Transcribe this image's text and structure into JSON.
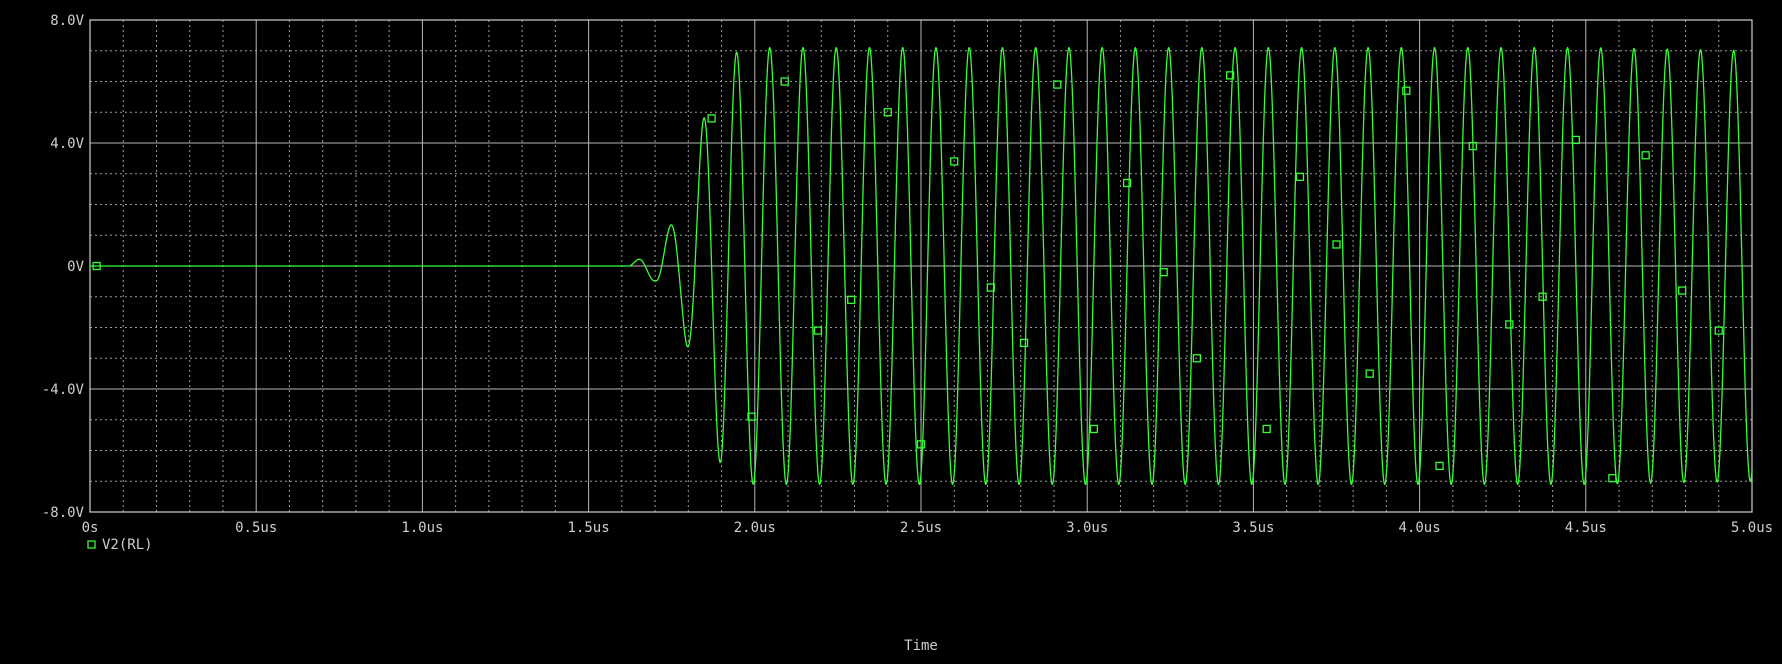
{
  "chart_data": {
    "type": "line",
    "title": "",
    "xlabel": "Time",
    "ylabel": "",
    "xlim": [
      0,
      5.0
    ],
    "ylim": [
      -8.0,
      8.0
    ],
    "x_unit": "us",
    "y_unit": "V",
    "grid": true,
    "legend_placement": "bottom-left",
    "x_ticks": [
      0,
      0.5,
      1.0,
      1.5,
      2.0,
      2.5,
      3.0,
      3.5,
      4.0,
      4.5,
      5.0
    ],
    "x_tick_labels": [
      "0s",
      "0.5us",
      "1.0us",
      "1.5us",
      "2.0us",
      "2.5us",
      "3.0us",
      "3.5us",
      "4.0us",
      "4.5us",
      "5.0us"
    ],
    "y_ticks": [
      8.0,
      4.0,
      0,
      -4.0,
      -8.0
    ],
    "y_tick_labels": [
      "8.0V",
      "4.0V",
      "0V",
      "-4.0V",
      "-8.0V"
    ],
    "series": [
      {
        "name": "V2(RL)",
        "color": "#33ff33",
        "marker": "square",
        "x": [
          0.0,
          1.62,
          1.66,
          1.7,
          1.74,
          1.78,
          1.82,
          1.86,
          1.9,
          1.95,
          2.0,
          2.05,
          2.1,
          2.2,
          2.3,
          2.4,
          2.5,
          3.0,
          3.5,
          4.0,
          4.5,
          5.0
        ],
        "envelope_amplitude": [
          0.0,
          0.0,
          0.3,
          0.5,
          1.2,
          2.0,
          3.5,
          5.5,
          6.5,
          7.0,
          7.1,
          7.1,
          7.1,
          7.1,
          7.1,
          7.1,
          7.1,
          7.1,
          7.1,
          7.1,
          7.1,
          7.0
        ],
        "frequency_mhz": 10.0,
        "marker_points": [
          [
            0.02,
            0.0
          ],
          [
            1.87,
            4.8
          ],
          [
            1.99,
            -4.9
          ],
          [
            2.09,
            6.0
          ],
          [
            2.19,
            -2.1
          ],
          [
            2.29,
            -1.1
          ],
          [
            2.4,
            5.0
          ],
          [
            2.5,
            -5.8
          ],
          [
            2.6,
            3.4
          ],
          [
            2.71,
            -0.7
          ],
          [
            2.81,
            -2.5
          ],
          [
            2.91,
            5.9
          ],
          [
            3.02,
            -5.3
          ],
          [
            3.12,
            2.7
          ],
          [
            3.23,
            -0.2
          ],
          [
            3.33,
            -3.0
          ],
          [
            3.43,
            6.2
          ],
          [
            3.54,
            -5.3
          ],
          [
            3.64,
            2.9
          ],
          [
            3.75,
            0.7
          ],
          [
            3.85,
            -3.5
          ],
          [
            3.96,
            5.7
          ],
          [
            4.06,
            -6.5
          ],
          [
            4.16,
            3.9
          ],
          [
            4.27,
            -1.9
          ],
          [
            4.37,
            -1.0
          ],
          [
            4.47,
            4.1
          ],
          [
            4.58,
            -6.9
          ],
          [
            4.68,
            3.6
          ],
          [
            4.79,
            -0.8
          ],
          [
            4.9,
            -2.1
          ]
        ]
      }
    ]
  }
}
